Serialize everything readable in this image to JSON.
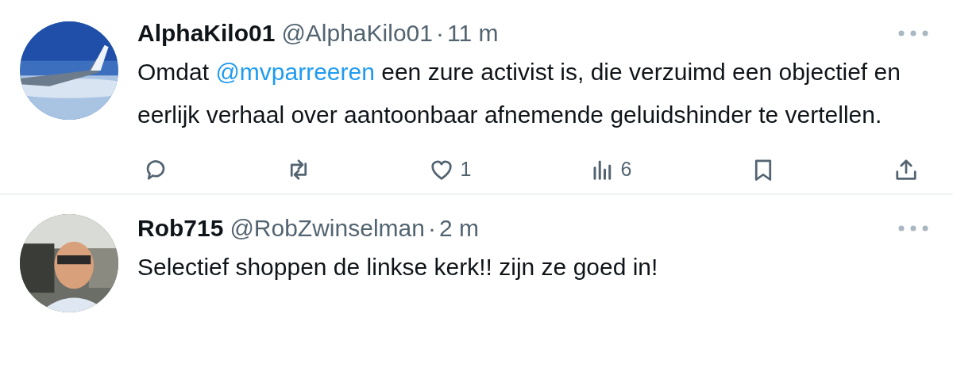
{
  "tweets": [
    {
      "avatar": {
        "kind": "picture"
      },
      "display_name": "AlphaKilo01",
      "handle": "@AlphaKilo01",
      "separator": "·",
      "time": "11 m",
      "body": [
        {
          "kind": "text",
          "text": "Omdat "
        },
        {
          "kind": "mention",
          "text": "@mvparreeren"
        },
        {
          "kind": "text",
          "text": " een zure activist is, die verzuimd een objectief en eerlijk verhaal over aantoonbaar afnemende geluidshinder te vertellen."
        }
      ],
      "actions": [
        {
          "kind": "reply"
        },
        {
          "kind": "retweet"
        },
        {
          "kind": "like",
          "count": "1"
        },
        {
          "kind": "views",
          "count": "6"
        },
        {
          "kind": "bookmark"
        },
        {
          "kind": "share"
        }
      ]
    },
    {
      "avatar": {
        "kind": "picture"
      },
      "display_name": "Rob715",
      "handle": "@RobZwinselman",
      "separator": "·",
      "time": "2 m",
      "body": [
        {
          "kind": "text",
          "text": "Selectief shoppen de linkse kerk!! zijn ze goed in!"
        }
      ]
    }
  ]
}
